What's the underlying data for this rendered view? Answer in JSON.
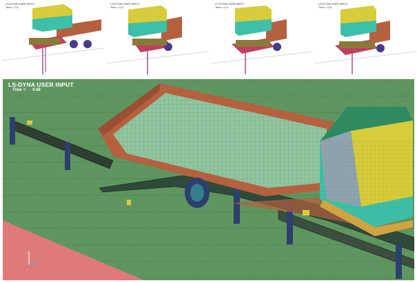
{
  "thumbnails": [
    {
      "title": "LS-DYNA USER INPUT",
      "time_label": "Time =",
      "time_value": "0.0"
    },
    {
      "title": "LS-DYNA USER INPUT",
      "time_label": "Time =",
      "time_value": "0.2"
    },
    {
      "title": "LS-DYNA USER INPUT",
      "time_label": "Time =",
      "time_value": "0.4"
    },
    {
      "title": "LS-DYNA USER INPUT",
      "time_label": "Time =",
      "time_value": "0.6"
    }
  ],
  "main_view": {
    "title": "LS-DYNA USER INPUT",
    "time_label": "Time =",
    "time_value": "0.68"
  },
  "colors": {
    "ground": "#5f9660",
    "truck_bed": "#b5603f",
    "bed_floor": "#8fc6a0",
    "cab_yellow": "#d8cc3a",
    "cab_teal": "#3ec0a8",
    "post_blue": "#2c3f6d",
    "pink_area": "#e07a7a"
  }
}
